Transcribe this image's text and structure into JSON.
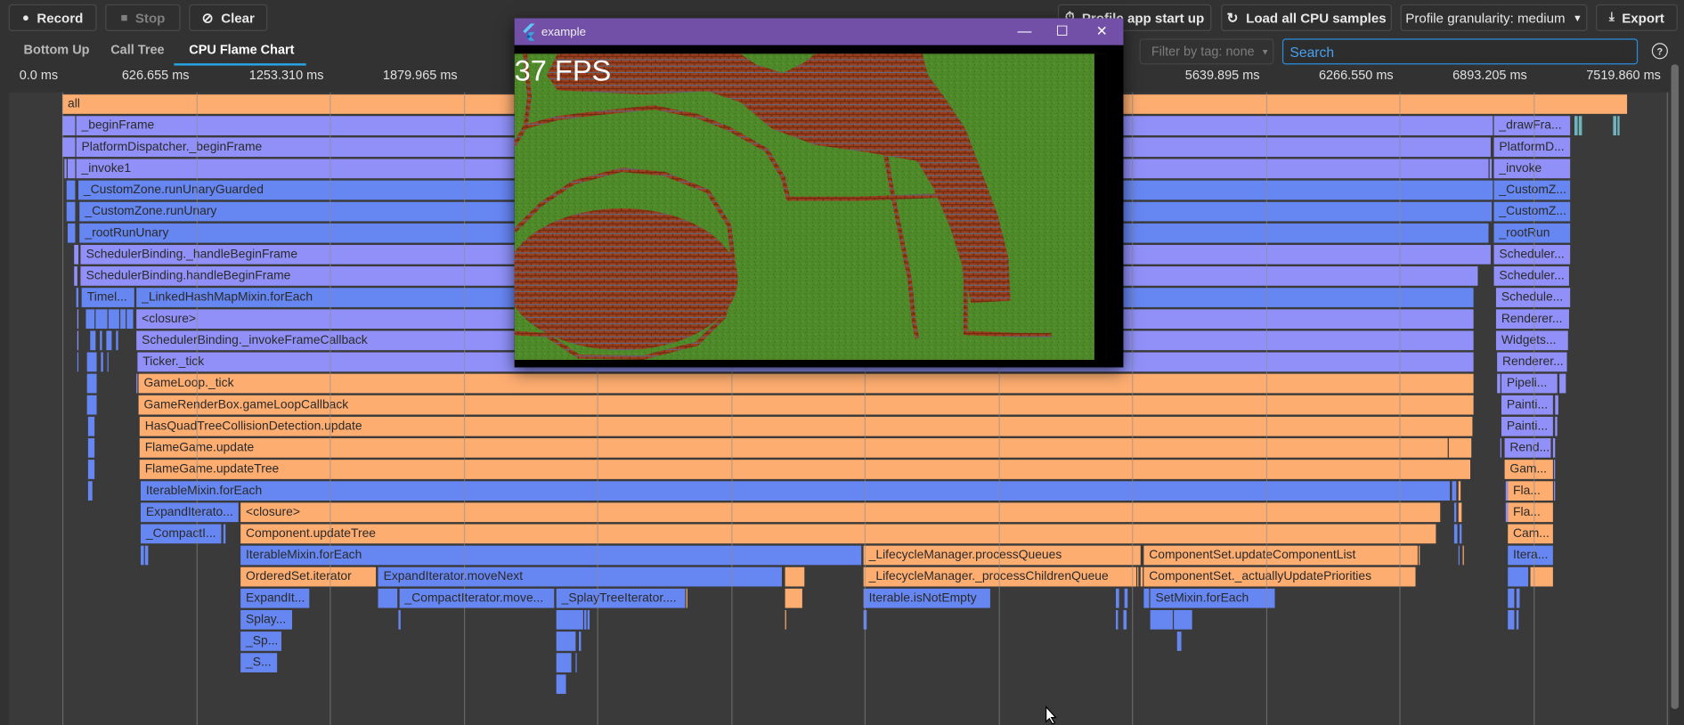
{
  "toolbar": {
    "record": {
      "label": "Record",
      "icon": "record-icon"
    },
    "stop": {
      "label": "Stop",
      "icon": "stop-icon"
    },
    "clear": {
      "label": "Clear",
      "icon": "clear-icon"
    },
    "profile_startup": {
      "label": "Profile app start up",
      "icon": "timer-icon"
    },
    "load_all": {
      "label": "Load all CPU samples",
      "icon": "refresh-icon"
    },
    "granularity": {
      "label": "Profile granularity: medium"
    },
    "export": {
      "label": "Export",
      "icon": "download-icon"
    }
  },
  "tabs": [
    {
      "label": "Bottom Up",
      "active": false
    },
    {
      "label": "Call Tree",
      "active": false
    },
    {
      "label": "CPU Flame Chart",
      "active": true
    }
  ],
  "filter": {
    "label": "Filter by tag: none"
  },
  "search": {
    "placeholder": "Search",
    "value": ""
  },
  "help": {
    "label": "?"
  },
  "timeline": {
    "tick_interval_ms": 626.655,
    "visible_ticks": [
      {
        "index": 0,
        "label": "0.0 ms"
      },
      {
        "index": 1,
        "label": "626.655 ms"
      },
      {
        "index": 2,
        "label": "1253.310 ms"
      },
      {
        "index": 3,
        "label": "1879.965 ms"
      },
      {
        "index": 9,
        "label": "5639.895 ms"
      },
      {
        "index": 10,
        "label": "6266.550 ms"
      },
      {
        "index": 11,
        "label": "6893.205 ms"
      },
      {
        "index": 12,
        "label": "7519.860 ms"
      }
    ]
  },
  "colors": {
    "app": "#fdad70",
    "flutter": "#9090f8",
    "dart": "#6686f2",
    "native": "#6fb4bd",
    "accent": "#28a7e8"
  },
  "flame_nodes": [
    [
      0,
      0,
      7333,
      "app",
      "all"
    ],
    [
      1,
      0,
      60,
      "flutter",
      ""
    ],
    [
      1,
      65,
      6704,
      "flutter",
      "_beginFrame"
    ],
    [
      1,
      6709,
      7066,
      "flutter",
      "_drawFra..."
    ],
    [
      1,
      7086,
      7101,
      "native",
      ""
    ],
    [
      1,
      7106,
      7122,
      "native",
      ""
    ],
    [
      1,
      7268,
      7283,
      "native",
      ""
    ],
    [
      1,
      7288,
      7298,
      "native",
      ""
    ],
    [
      2,
      0,
      60,
      "flutter",
      ""
    ],
    [
      2,
      65,
      6694,
      "flutter",
      "PlatformDispatcher._beginFrame"
    ],
    [
      2,
      6709,
      7066,
      "flutter",
      "PlatformD..."
    ],
    [
      3,
      10,
      20,
      "flutter",
      ""
    ],
    [
      3,
      25,
      60,
      "flutter",
      ""
    ],
    [
      3,
      65,
      6684,
      "flutter",
      "_invoke1"
    ],
    [
      3,
      6689,
      6699,
      "flutter",
      ""
    ],
    [
      3,
      6709,
      7066,
      "flutter",
      "_invoke"
    ],
    [
      4,
      20,
      60,
      "dart",
      ""
    ],
    [
      4,
      75,
      6704,
      "dart",
      "_CustomZone.runUnaryGuarded"
    ],
    [
      4,
      6709,
      7066,
      "dart",
      "_CustomZ..."
    ],
    [
      5,
      20,
      60,
      "dart",
      ""
    ],
    [
      5,
      81,
      6699,
      "dart",
      "_CustomZone.runUnary"
    ],
    [
      5,
      6709,
      7066,
      "dart",
      "_CustomZ..."
    ],
    [
      6,
      25,
      60,
      "dart",
      ""
    ],
    [
      6,
      81,
      6684,
      "dart",
      "_rootRunUnary"
    ],
    [
      6,
      6709,
      7066,
      "dart",
      "_rootRun"
    ],
    [
      7,
      55,
      75,
      "flutter",
      ""
    ],
    [
      7,
      86,
      6694,
      "flutter",
      "SchedulerBinding._handleBeginFrame"
    ],
    [
      7,
      6709,
      7066,
      "flutter",
      "Scheduler..."
    ],
    [
      8,
      55,
      70,
      "flutter",
      ""
    ],
    [
      8,
      86,
      6633,
      "flutter",
      "SchedulerBinding.handleBeginFrame"
    ],
    [
      8,
      6709,
      7060,
      "flutter",
      "Scheduler..."
    ],
    [
      9,
      65,
      75,
      "dart",
      ""
    ],
    [
      9,
      91,
      337,
      "dart",
      "Timel..."
    ],
    [
      9,
      347,
      6613,
      "dart",
      "_LinkedHashMapMixin.forEach"
    ],
    [
      9,
      6719,
      7066,
      "flutter",
      "Schedule..."
    ],
    [
      10,
      70,
      75,
      "flutter",
      ""
    ],
    [
      10,
      111,
      151,
      "dart",
      ""
    ],
    [
      10,
      156,
      211,
      "dart",
      ""
    ],
    [
      10,
      216,
      267,
      "dart",
      ""
    ],
    [
      10,
      272,
      297,
      "dart",
      ""
    ],
    [
      10,
      302,
      332,
      "dart",
      ""
    ],
    [
      10,
      347,
      6613,
      "flutter",
      "<closure>"
    ],
    [
      10,
      6719,
      7060,
      "flutter",
      "Renderer..."
    ],
    [
      11,
      70,
      75,
      "flutter",
      ""
    ],
    [
      11,
      131,
      156,
      "dart",
      ""
    ],
    [
      11,
      176,
      186,
      "dart",
      ""
    ],
    [
      11,
      206,
      232,
      "dart",
      ""
    ],
    [
      11,
      252,
      262,
      "dart",
      ""
    ],
    [
      11,
      347,
      6613,
      "flutter",
      "SchedulerBinding._invokeFrameCallback"
    ],
    [
      11,
      6719,
      7055,
      "flutter",
      "Widgets..."
    ],
    [
      12,
      70,
      75,
      "dart",
      ""
    ],
    [
      12,
      116,
      161,
      "dart",
      ""
    ],
    [
      12,
      181,
      191,
      "dart",
      ""
    ],
    [
      12,
      211,
      216,
      "dart",
      ""
    ],
    [
      12,
      352,
      6613,
      "flutter",
      "Ticker._tick"
    ],
    [
      12,
      6724,
      7050,
      "flutter",
      "Renderer..."
    ],
    [
      13,
      116,
      161,
      "dart",
      ""
    ],
    [
      13,
      347,
      352,
      "flutter",
      ""
    ],
    [
      13,
      357,
      6613,
      "app",
      "GameLoop._tick"
    ],
    [
      13,
      6724,
      6739,
      "flutter",
      ""
    ],
    [
      13,
      6744,
      7005,
      "flutter",
      "Pipeli..."
    ],
    [
      13,
      7015,
      7045,
      "flutter",
      ""
    ],
    [
      14,
      116,
      161,
      "dart",
      ""
    ],
    [
      14,
      357,
      6613,
      "app",
      "GameRenderBox.gameLoopCallback"
    ],
    [
      14,
      6744,
      6985,
      "flutter",
      "Painti..."
    ],
    [
      14,
      6995,
      7010,
      "flutter",
      ""
    ],
    [
      15,
      121,
      151,
      "dart",
      ""
    ],
    [
      15,
      362,
      6608,
      "app",
      "HasQuadTreeCollisionDetection.update"
    ],
    [
      15,
      6744,
      6985,
      "flutter",
      "Painti..."
    ],
    [
      15,
      6995,
      7005,
      "flutter",
      ""
    ],
    [
      16,
      121,
      151,
      "dart",
      ""
    ],
    [
      16,
      362,
      6493,
      "app",
      "FlameGame.update"
    ],
    [
      16,
      6498,
      6603,
      "app",
      ""
    ],
    [
      16,
      6739,
      6744,
      "flutter",
      ""
    ],
    [
      16,
      6759,
      6975,
      "flutter",
      "Rend..."
    ],
    [
      16,
      6985,
      6995,
      "flutter",
      ""
    ],
    [
      17,
      121,
      151,
      "dart",
      ""
    ],
    [
      17,
      362,
      6598,
      "app",
      "FlameGame.updateTree"
    ],
    [
      17,
      6759,
      6985,
      "app",
      "Gam..."
    ],
    [
      17,
      6990,
      6995,
      "flutter",
      ""
    ],
    [
      18,
      121,
      141,
      "dart",
      ""
    ],
    [
      18,
      367,
      6503,
      "dart",
      "IterableMixin.forEach"
    ],
    [
      18,
      6513,
      6533,
      "dart",
      ""
    ],
    [
      18,
      6543,
      6553,
      "app",
      ""
    ],
    [
      18,
      6764,
      6774,
      "flutter",
      ""
    ],
    [
      18,
      6774,
      6985,
      "app",
      "Fla..."
    ],
    [
      18,
      6990,
      6995,
      "flutter",
      ""
    ],
    [
      19,
      367,
      825,
      "dart",
      "ExpandIterato..."
    ],
    [
      19,
      835,
      6457,
      "app",
      "<closure>"
    ],
    [
      19,
      6523,
      6533,
      "dart",
      ""
    ],
    [
      19,
      6543,
      6558,
      "app",
      ""
    ],
    [
      19,
      6764,
      6774,
      "flutter",
      ""
    ],
    [
      19,
      6774,
      6985,
      "app",
      "Fla..."
    ],
    [
      20,
      367,
      745,
      "dart",
      "_CompactI..."
    ],
    [
      20,
      755,
      765,
      "dart",
      ""
    ],
    [
      20,
      835,
      6437,
      "app",
      "Component.updateTree"
    ],
    [
      20,
      6523,
      6538,
      "dart",
      ""
    ],
    [
      20,
      6548,
      6558,
      "dart",
      ""
    ],
    [
      20,
      6774,
      6985,
      "app",
      "Cam..."
    ],
    [
      21,
      367,
      383,
      "dart",
      ""
    ],
    [
      21,
      388,
      403,
      "dart",
      ""
    ],
    [
      21,
      835,
      3744,
      "dart",
      "IterableMixin.forEach"
    ],
    [
      21,
      3755,
      5053,
      "app",
      "_LifecycleManager.processQueues"
    ],
    [
      21,
      5068,
      6352,
      "app",
      "ComponentSet.updateComponentList"
    ],
    [
      21,
      6357,
      6362,
      "app",
      ""
    ],
    [
      21,
      6543,
      6548,
      "dart",
      ""
    ],
    [
      21,
      6563,
      6568,
      "app",
      ""
    ],
    [
      21,
      6774,
      6985,
      "dart",
      "Itera..."
    ],
    [
      22,
      835,
      1470,
      "app",
      "OrderedSet.iterator"
    ],
    [
      22,
      1480,
      3372,
      "dart",
      "ExpandIterator.moveNext"
    ],
    [
      22,
      3387,
      3478,
      "app",
      ""
    ],
    [
      22,
      3755,
      5033,
      "app",
      "_LifecycleManager._processChildrenQueue"
    ],
    [
      22,
      5038,
      5043,
      "app",
      ""
    ],
    [
      22,
      5053,
      5063,
      "app",
      ""
    ],
    [
      22,
      5068,
      6342,
      "app",
      "ComponentSet._actuallyUpdatePriorities"
    ],
    [
      22,
      6774,
      6870,
      "dart",
      ""
    ],
    [
      22,
      6880,
      6985,
      "app",
      ""
    ],
    [
      23,
      835,
      1158,
      "dart",
      "ExpandIt..."
    ],
    [
      23,
      1480,
      1570,
      "dart",
      ""
    ],
    [
      23,
      1580,
      2305,
      "dart",
      "_CompactIterator.move..."
    ],
    [
      23,
      2315,
      2919,
      "dart",
      "_SplayTreeIterator...."
    ],
    [
      23,
      2924,
      2929,
      "app",
      ""
    ],
    [
      23,
      3387,
      3468,
      "app",
      ""
    ],
    [
      23,
      3755,
      4349,
      "dart",
      "Iterable.isNotEmpty"
    ],
    [
      23,
      4938,
      4953,
      "dart",
      ""
    ],
    [
      23,
      4978,
      4993,
      "dart",
      ""
    ],
    [
      23,
      5068,
      5093,
      "dart",
      ""
    ],
    [
      23,
      5098,
      5682,
      "dart",
      "SetMixin.forEach"
    ],
    [
      23,
      6774,
      6805,
      "dart",
      ""
    ],
    [
      23,
      6815,
      6830,
      "dart",
      ""
    ],
    [
      24,
      835,
      1077,
      "dart",
      "Splay..."
    ],
    [
      24,
      1575,
      1585,
      "dart",
      ""
    ],
    [
      24,
      2315,
      2441,
      "dart",
      ""
    ],
    [
      24,
      2446,
      2456,
      "dart",
      ""
    ],
    [
      24,
      2461,
      2471,
      "dart",
      ""
    ],
    [
      24,
      3387,
      3392,
      "app",
      ""
    ],
    [
      24,
      3755,
      3770,
      "dart",
      ""
    ],
    [
      24,
      4938,
      4948,
      "dart",
      ""
    ],
    [
      24,
      4973,
      4988,
      "dart",
      ""
    ],
    [
      24,
      5098,
      5204,
      "dart",
      ""
    ],
    [
      24,
      5209,
      5294,
      "dart",
      ""
    ],
    [
      24,
      6774,
      6805,
      "dart",
      ""
    ],
    [
      24,
      6815,
      6825,
      "dart",
      ""
    ],
    [
      25,
      835,
      1027,
      "dart",
      "_Sp..."
    ],
    [
      25,
      2315,
      2406,
      "dart",
      ""
    ],
    [
      25,
      2421,
      2431,
      "dart",
      ""
    ],
    [
      25,
      5224,
      5244,
      "dart",
      ""
    ],
    [
      26,
      835,
      1007,
      "dart",
      "_S..."
    ],
    [
      26,
      2315,
      2386,
      "dart",
      ""
    ],
    [
      26,
      2406,
      2411,
      "dart",
      ""
    ],
    [
      27,
      2315,
      2361,
      "dart",
      ""
    ]
  ],
  "app_window": {
    "title": "example",
    "icon": "flutter-logo-icon",
    "controls": {
      "minimize": "minimize-icon",
      "maximize": "maximize-icon",
      "close": "close-icon"
    },
    "fps_label": "37 FPS",
    "colors": {
      "titlebar": "#7350a8",
      "grass": "#4f8a2a",
      "brick": "#9c3f1c"
    }
  }
}
